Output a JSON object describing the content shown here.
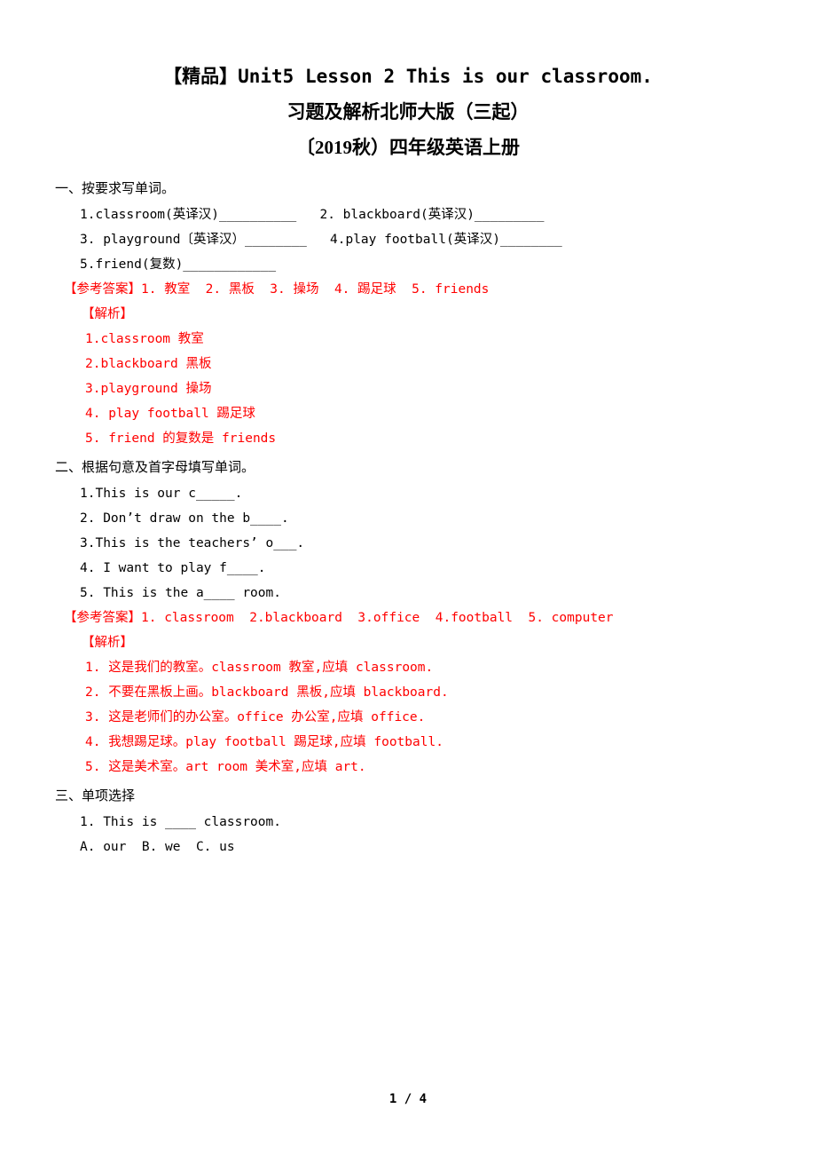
{
  "document": {
    "title_lines": [
      "【精品】Unit5 Lesson 2 This is our classroom.",
      "习题及解析北师大版（三起）",
      "〔2019秋）四年级英语上册"
    ],
    "sections": [
      {
        "heading": "一、按要求写单词。",
        "questions": [
          "1.classroom(英译汉)__________   2. blackboard(英译汉)_________",
          "3. playground〔英译汉）________   4.play football(英译汉)________",
          "5.friend(复数)____________"
        ],
        "answer_key": "【参考答案】1. 教室  2. 黑板  3. 操场  4. 踢足球  5. friends",
        "analysis_label": "【解析】",
        "analysis_lines": [
          "1.classroom 教室",
          "2.blackboard 黑板",
          "3.playground 操场",
          "4. play football 踢足球",
          "5. friend 的复数是 friends"
        ]
      },
      {
        "heading": "二、根据句意及首字母填写单词。",
        "questions": [
          "1.This is our c_____.",
          "2. Don’t draw on the b____.",
          "3.This is the teachers’ o___.",
          "4. I want to play f____.",
          "5. This is the a____ room."
        ],
        "answer_key": "【参考答案】1. classroom  2.blackboard  3.office  4.football  5. computer",
        "analysis_label": "【解析】",
        "analysis_lines": [
          "1. 这是我们的教室。classroom 教室,应填 classroom.",
          "2. 不要在黑板上画。blackboard 黑板,应填 blackboard.",
          "3. 这是老师们的办公室。office 办公室,应填 office.",
          "4. 我想踢足球。play football 踢足球,应填 football.",
          "5. 这是美术室。art room 美术室,应填 art."
        ]
      },
      {
        "heading": "三、单项选择",
        "questions": [
          "1. This is ____ classroom.",
          "A. our  B. we  C. us"
        ],
        "answer_key": "",
        "analysis_label": "",
        "analysis_lines": []
      }
    ],
    "footer": "1 / 4"
  }
}
